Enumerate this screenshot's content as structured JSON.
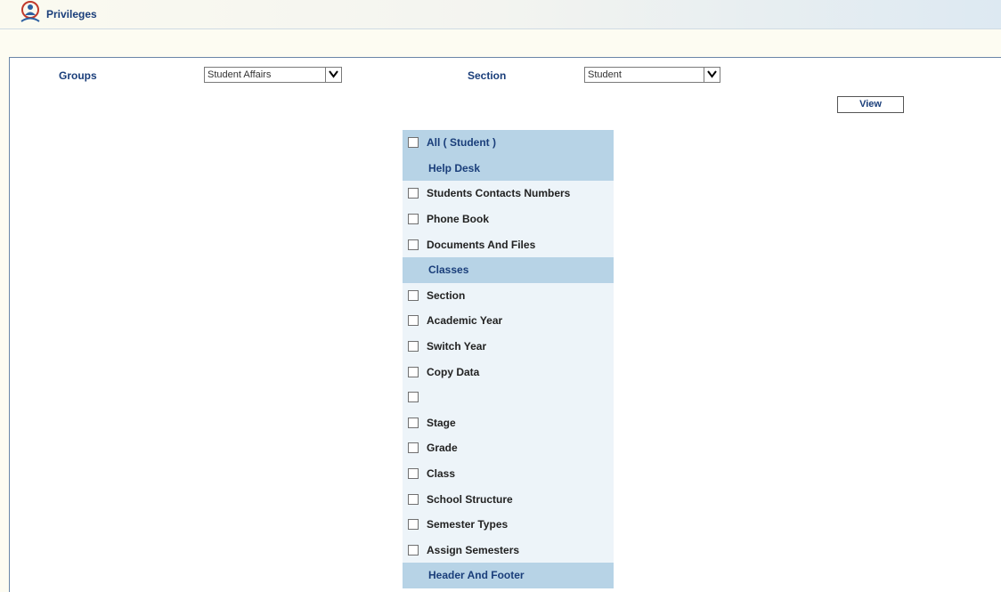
{
  "header": {
    "title": "Privileges",
    "icon": "user-group-icon"
  },
  "filters": {
    "groups_label": "Groups",
    "groups_value": "Student Affairs",
    "section_label": "Section",
    "section_value": "Student",
    "view_button": "View"
  },
  "list": {
    "all_label": "All ( Student )",
    "rows": [
      {
        "type": "header",
        "label": "Help Desk"
      },
      {
        "type": "item",
        "label": "Students Contacts Numbers"
      },
      {
        "type": "item",
        "label": "Phone Book"
      },
      {
        "type": "item",
        "label": "Documents And Files"
      },
      {
        "type": "header",
        "label": "Classes"
      },
      {
        "type": "item",
        "label": "Section"
      },
      {
        "type": "item",
        "label": "Academic Year"
      },
      {
        "type": "item",
        "label": "Switch Year"
      },
      {
        "type": "item",
        "label": "Copy Data"
      },
      {
        "type": "item",
        "label": ""
      },
      {
        "type": "item",
        "label": "Stage"
      },
      {
        "type": "item",
        "label": "Grade"
      },
      {
        "type": "item",
        "label": "Class"
      },
      {
        "type": "item",
        "label": "School Structure"
      },
      {
        "type": "item",
        "label": "Semester Types"
      },
      {
        "type": "item",
        "label": "Assign Semesters"
      },
      {
        "type": "header",
        "label": "Header And Footer"
      }
    ]
  },
  "colors": {
    "accent_text": "#1a3e7a",
    "section_header_bg": "#b7d3e6",
    "list_bg": "#edf4f9"
  }
}
